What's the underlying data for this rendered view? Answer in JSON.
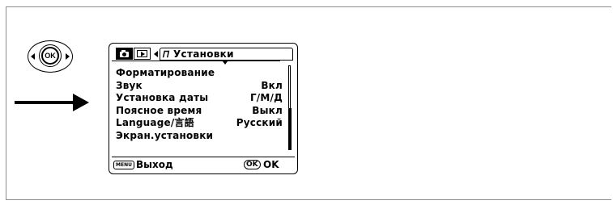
{
  "controller": {
    "center_label": "OK"
  },
  "lcd": {
    "tabs": {
      "camera_icon": "camera-icon",
      "playback_icon": "playback-icon",
      "setup_icon": "wrench-icon",
      "setup_title": "Установки"
    },
    "rows": [
      {
        "label": "Форматирование",
        "value": ""
      },
      {
        "label": "Звук",
        "value": "Вкл"
      },
      {
        "label": "Установка даты",
        "value": "Г/М/Д"
      },
      {
        "label": "Поясное время",
        "value": "Выкл"
      },
      {
        "label": "Language/言語",
        "value": "Русский"
      },
      {
        "label": "Экран.установки",
        "value": ""
      }
    ],
    "footer": {
      "menu_badge": "MENU",
      "menu_action": "Выход",
      "ok_badge": "OK",
      "ok_action": "OK"
    }
  }
}
